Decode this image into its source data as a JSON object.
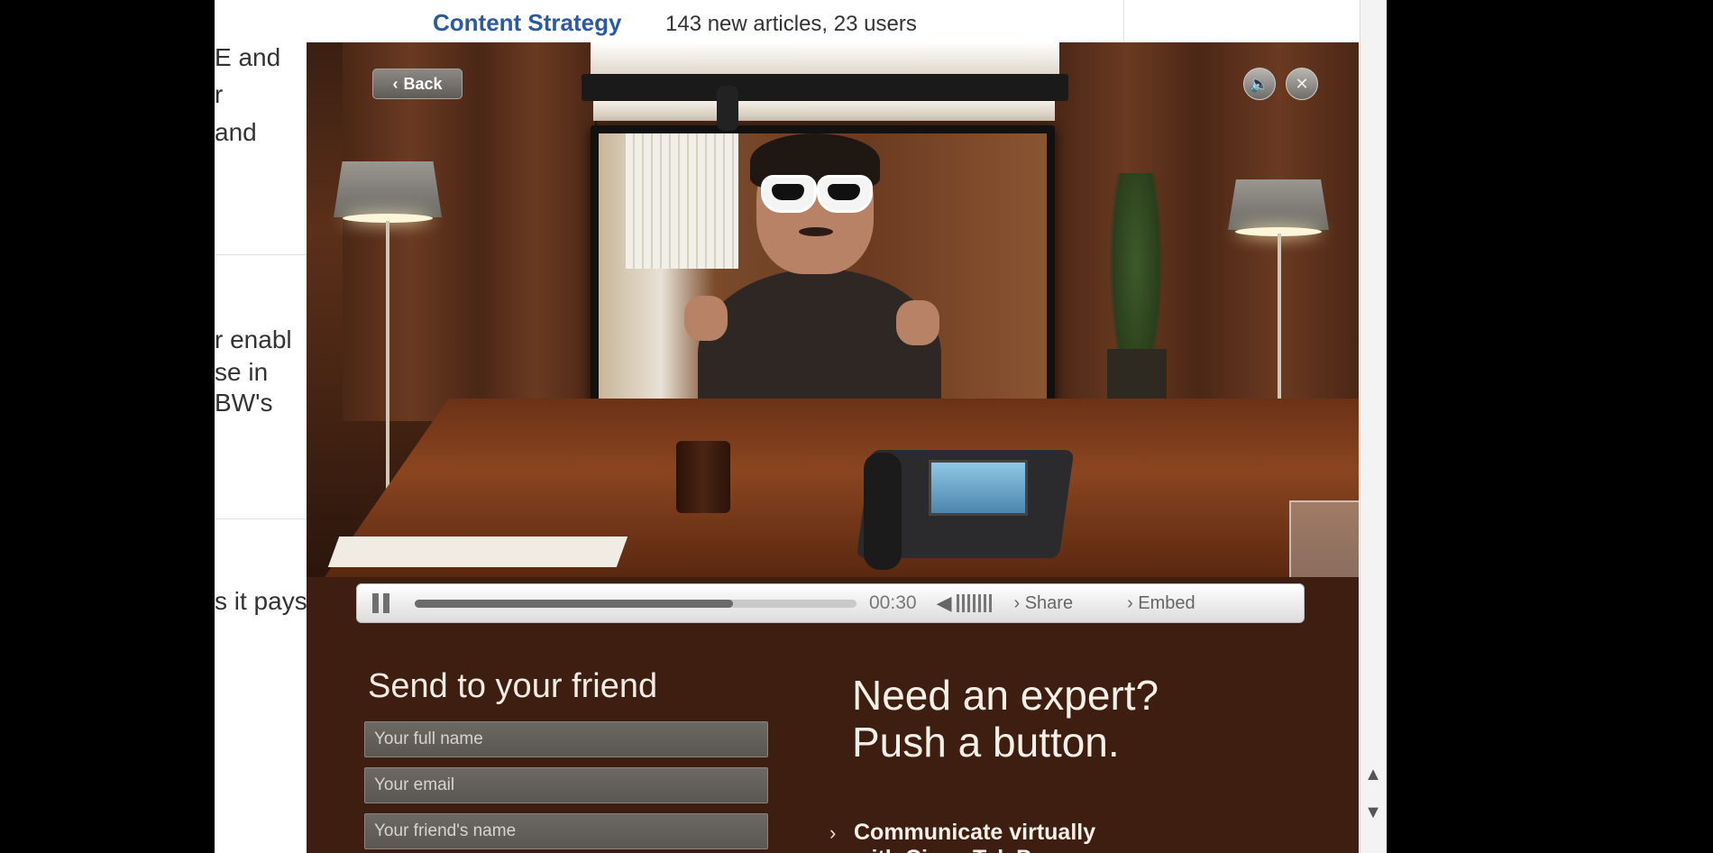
{
  "background_page": {
    "content_link": "Content Strategy",
    "content_meta": "143 new articles, 23 users",
    "left_col_snippets": [
      {
        "line": "E and"
      },
      {
        "line": "r"
      },
      {
        "line": " and"
      },
      {
        "line": "r enabl"
      },
      {
        "line": "se in"
      },
      {
        "line": "BW's"
      },
      {
        "line": "s it pays"
      }
    ],
    "scroll_up_icon": "triangle-up",
    "scroll_down_icon": "triangle-down"
  },
  "modal": {
    "back_label": "Back",
    "back_icon": "chevron-left",
    "mute_icon": "speaker",
    "close_icon": "x",
    "player": {
      "progress": 0.72,
      "time": "00:30",
      "share_label": "Share",
      "embed_label": "Embed"
    },
    "send_form": {
      "heading": "Send to your friend",
      "name_placeholder": "Your full name",
      "email_placeholder": "Your email",
      "friend_placeholder": "Your friend's name"
    },
    "expert": {
      "heading_line1": "Need an expert?",
      "heading_line2": "Push a button.",
      "link_line1": "Communicate virtually",
      "link_line2": "with Cisco TelePresence"
    }
  }
}
